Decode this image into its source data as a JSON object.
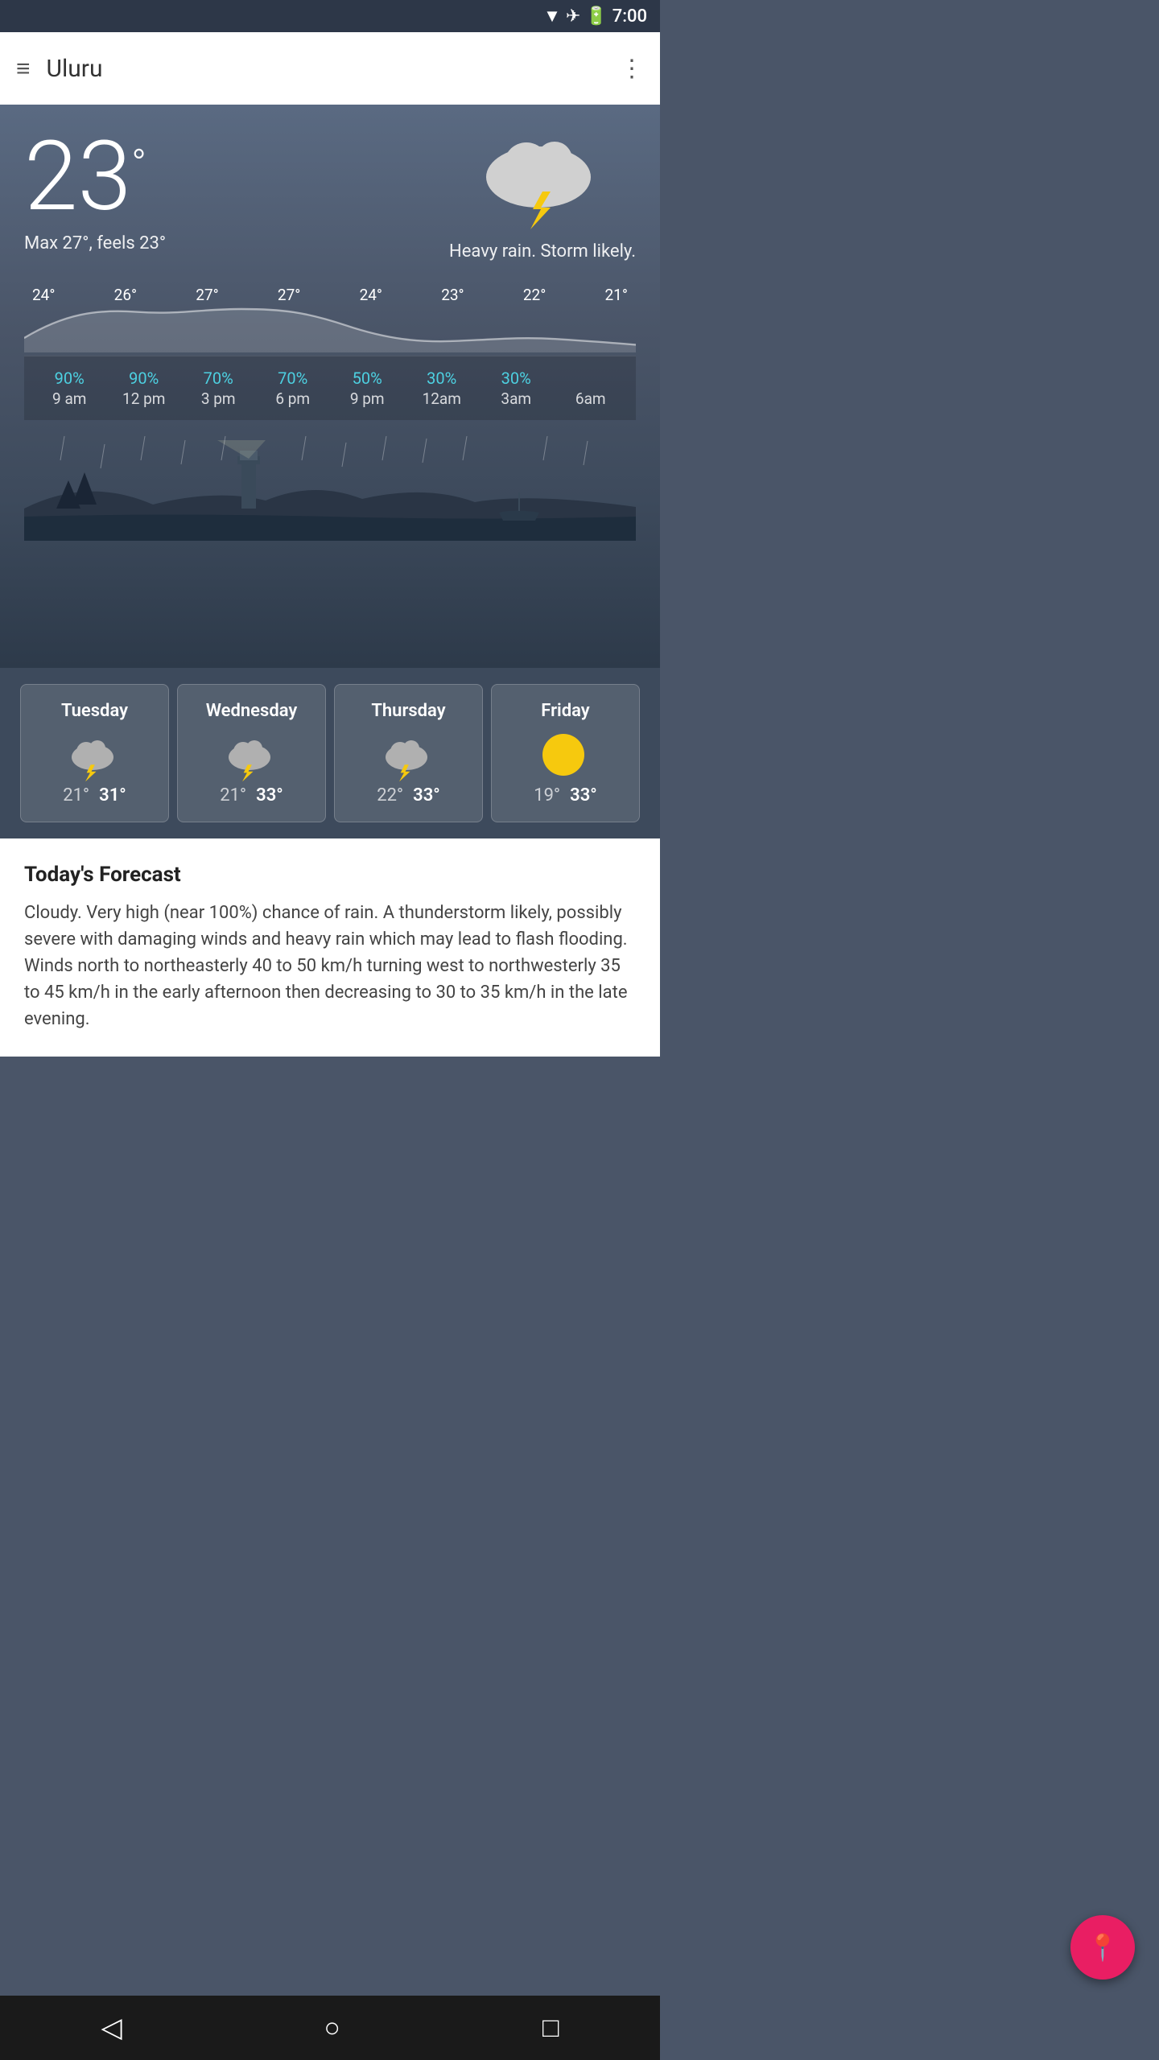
{
  "statusBar": {
    "time": "7:00",
    "icons": [
      "wifi",
      "airplane",
      "battery"
    ]
  },
  "topBar": {
    "menuLabel": "≡",
    "title": "Uluru",
    "moreLabel": "⋮"
  },
  "currentWeather": {
    "temperature": "23",
    "degreeSymbol": "°",
    "maxTemp": "Max 27°, feels 23°",
    "description": "Heavy rain. Storm likely."
  },
  "hourly": [
    {
      "temp": "24°",
      "precip": "90%",
      "time": "9 am"
    },
    {
      "temp": "26°",
      "precip": "90%",
      "time": "12 pm"
    },
    {
      "temp": "27°",
      "precip": "70%",
      "time": "3 pm"
    },
    {
      "temp": "27°",
      "precip": "70%",
      "time": "6 pm"
    },
    {
      "temp": "24°",
      "precip": "50%",
      "time": "9 pm"
    },
    {
      "temp": "23°",
      "precip": "30%",
      "time": "12am"
    },
    {
      "temp": "22°",
      "precip": "30%",
      "time": "3am"
    },
    {
      "temp": "21°",
      "precip": "",
      "time": "6am"
    }
  ],
  "daily": [
    {
      "day": "Tuesday",
      "icon": "cloud-lightning",
      "low": "21°",
      "high": "31°"
    },
    {
      "day": "Wednesday",
      "icon": "cloud-lightning",
      "low": "21°",
      "high": "33°"
    },
    {
      "day": "Thursday",
      "icon": "cloud-lightning",
      "low": "22°",
      "high": "33°"
    },
    {
      "day": "Friday",
      "icon": "sun",
      "low": "19°",
      "high": "33°"
    }
  ],
  "todaysForecast": {
    "title": "Today's Forecast",
    "text": "Cloudy. Very high (near 100%) chance of rain. A thunderstorm likely, possibly severe with damaging winds and heavy rain which may lead to flash flooding. Winds north to northeasterly 40 to 50 km/h turning west to northwesterly 35 to 45 km/h in the early afternoon then decreasing to 30 to 35 km/h in the late evening."
  },
  "fab": {
    "icon": "📍"
  },
  "bottomNav": {
    "back": "◁",
    "home": "○",
    "square": "□"
  }
}
